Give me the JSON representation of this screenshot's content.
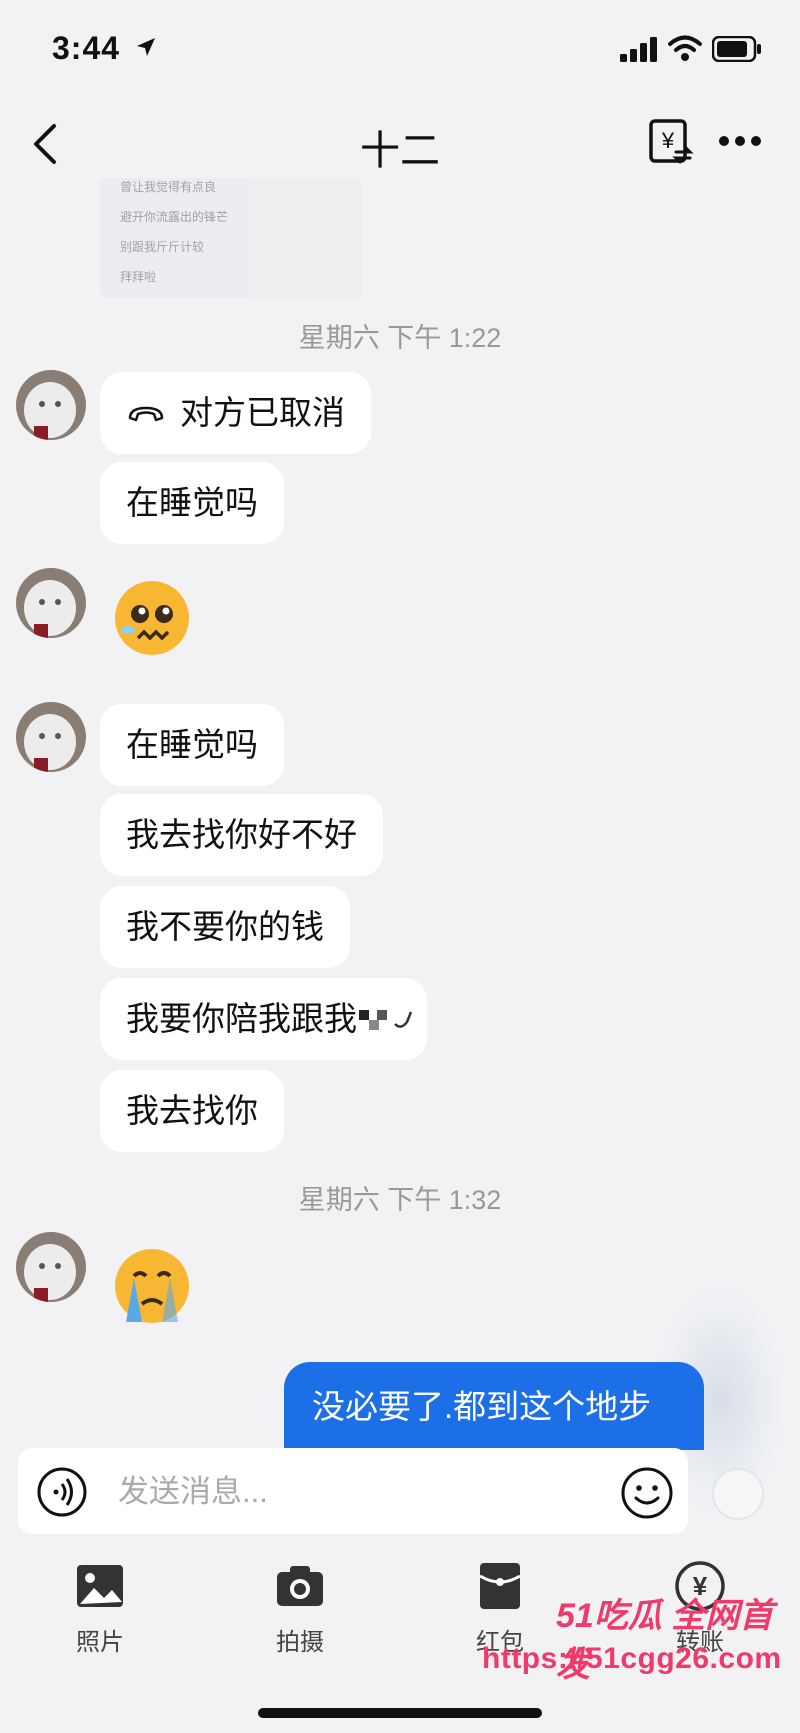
{
  "status_bar": {
    "time": "3:44"
  },
  "nav": {
    "title": "十二"
  },
  "faded_image": {
    "lines": [
      "曾让我觉得有点良",
      "避开你流露出的锋芒",
      "别跟我斤斤计较",
      "拜拜啦"
    ]
  },
  "timestamps": [
    "星期六 下午 1:22",
    "星期六 下午 1:32"
  ],
  "messages": {
    "call": "对方已取消",
    "m1": "在睡觉吗",
    "m2": "在睡觉吗",
    "m3": "我去找你好不好",
    "m4": "我不要你的钱",
    "m5": "我要你陪我跟我",
    "m6": "我去找你",
    "mine": "没必要了.都到这个地步"
  },
  "input": {
    "placeholder": "发送消息..."
  },
  "toolbar": {
    "photo": "照片",
    "camera": "拍摄",
    "red_packet": "红包",
    "transfer": "转账"
  },
  "watermark": {
    "line1": "51吃瓜 全网首发",
    "line2": "https://51cgg26.com"
  },
  "colors": {
    "my_bubble": "#1d6fe8",
    "watermark": "#f03a6a"
  }
}
